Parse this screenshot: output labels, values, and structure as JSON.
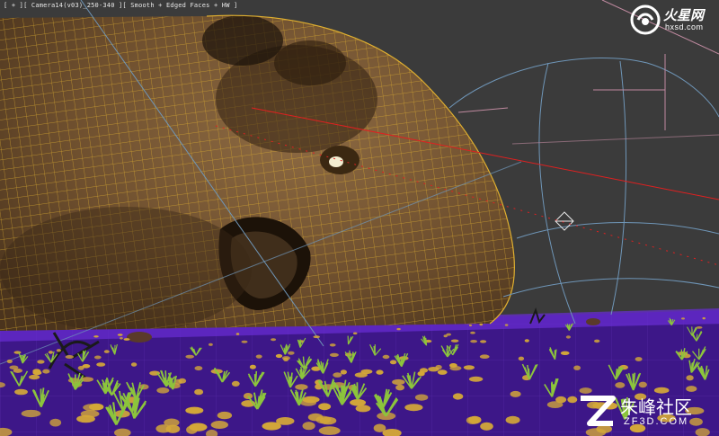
{
  "viewport": {
    "label": "[ + ][ Camera14(v03)_250-340 ][ Smooth + Edged Faces + HW ]"
  },
  "watermark_top": {
    "title": "火星网",
    "subtitle": "hxsd.com",
    "logo_icon": "hxsd-logo-icon"
  },
  "watermark_bottom": {
    "title": "朱峰社区",
    "subtitle": "ZF3D.COM",
    "logo_icon": "zf3d-logo-icon"
  },
  "colors": {
    "background": "#3b3b3b",
    "mesh_fill": "#7a5a36",
    "wire": "#e0b030",
    "ground": "#4a1aa0",
    "light_cone": "#6f96b8",
    "red_line": "#e02020",
    "pink_line": "#c08aa0",
    "grass": "#8cc43c",
    "rocks": "#d4a838"
  }
}
